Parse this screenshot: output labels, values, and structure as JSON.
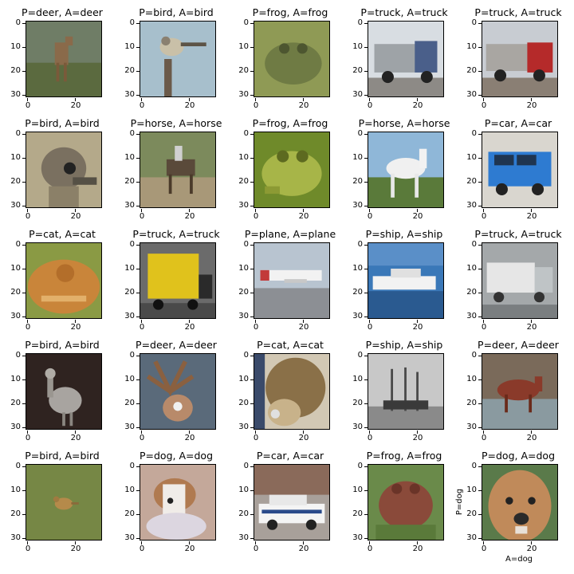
{
  "figure": {
    "panels": [
      {
        "title": "P=deer, A=deer",
        "scene": "deer"
      },
      {
        "title": "P=bird, A=bird",
        "scene": "bird-branch"
      },
      {
        "title": "P=frog, A=frog",
        "scene": "frog"
      },
      {
        "title": "P=truck, A=truck",
        "scene": "truck-white"
      },
      {
        "title": "P=truck, A=truck",
        "scene": "truck-red"
      },
      {
        "title": "P=bird, A=bird",
        "scene": "ostrich"
      },
      {
        "title": "P=horse, A=horse",
        "scene": "horse-rider"
      },
      {
        "title": "P=frog, A=frog",
        "scene": "frog-green"
      },
      {
        "title": "P=horse, A=horse",
        "scene": "horse-white"
      },
      {
        "title": "P=car, A=car",
        "scene": "car-blue"
      },
      {
        "title": "P=cat, A=cat",
        "scene": "cat-orange"
      },
      {
        "title": "P=truck, A=truck",
        "scene": "truck-yellow"
      },
      {
        "title": "P=plane, A=plane",
        "scene": "plane"
      },
      {
        "title": "P=ship, A=ship",
        "scene": "ship-boat"
      },
      {
        "title": "P=truck, A=truck",
        "scene": "truck-gray"
      },
      {
        "title": "P=bird, A=bird",
        "scene": "bird-dark"
      },
      {
        "title": "P=deer, A=deer",
        "scene": "deer-antlers"
      },
      {
        "title": "P=cat, A=cat",
        "scene": "cat-tabby"
      },
      {
        "title": "P=ship, A=ship",
        "scene": "ship-gray"
      },
      {
        "title": "P=deer, A=deer",
        "scene": "deer-brown"
      },
      {
        "title": "P=bird, A=bird",
        "scene": "bird-grass"
      },
      {
        "title": "P=dog, A=dog",
        "scene": "dog-white"
      },
      {
        "title": "P=car, A=car",
        "scene": "car-police"
      },
      {
        "title": "P=frog, A=frog",
        "scene": "frog-brown"
      },
      {
        "title": "P=dog, A=dog",
        "scene": "dog-face"
      }
    ],
    "y_ticks": [
      "0",
      "10",
      "20",
      "30"
    ],
    "x_ticks": [
      "0",
      "20"
    ],
    "last_panel_ylabel": "P=dog",
    "last_panel_xlabel": "A=dog"
  }
}
